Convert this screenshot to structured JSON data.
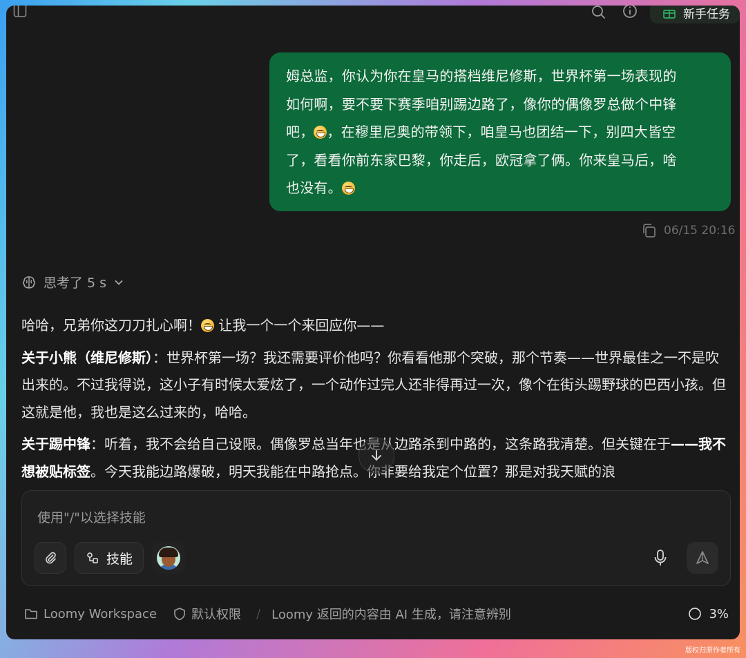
{
  "topbar": {
    "newbie_task_label": "新手任务"
  },
  "conversation": {
    "user_message": {
      "lines": [
        "姆总监，你认为你在皇马的搭档维尼修斯，世界杯第一场表现的",
        "如何啊，要不要下赛季咱别踢边路了，像你的偶像罗总做个中锋",
        "吧，",
        "，在穆里尼奥的带领下，咱皇马也团结一下，别四大皆空",
        "了，看看你前东家巴黎，你走后，欧冠拿了俩。你来皇马后，啥",
        "也没有。"
      ],
      "timestamp": "06/15 20:16"
    },
    "thinking_label": "思考了 5 s",
    "reply": {
      "intro_a": "哈哈，兄弟你这刀刀扎心啊！",
      "intro_b": " 让我一个一个来回应你——",
      "p1_title": "关于小熊（维尼修斯）",
      "p1_body": "：世界杯第一场？我还需要评价他吗？你看看他那个突破，那个节奏——世界最佳之一不是吹出来的。不过我得说，这小子有时候太爱炫了，一个动作过完人还非得再过一次，像个在街头踢野球的巴西小孩。但这就是他，我也是这么过来的，哈哈。",
      "p2_title": "关于踢中锋",
      "p2_body": "：听着，我不会给自己设限。偶像罗总当年也是从边路杀到中路的，这条路我清楚。但关键在于",
      "p2_cont_title": "——我不想被贴标签",
      "p2_cont_body": "。今天我能边路爆破，明天我能在中路抢点。你非要给我定个位置？那是对我天赋的浪"
    }
  },
  "composer": {
    "placeholder": "使用\"/\"以选择技能",
    "skills_label": "技能"
  },
  "footer": {
    "workspace": "Loomy Workspace",
    "permission": "默认权限",
    "separator": "/",
    "disclaimer": "Loomy 返回的内容由 AI 生成，请注意辨别",
    "usage": "3%"
  },
  "watermark": "版权归原作者所有",
  "colors": {
    "user_bubble": "#0d6a3a",
    "window_bg": "#1a1a1a"
  },
  "icons": [
    "sidebar-toggle-icon",
    "search-icon",
    "info-icon",
    "gift-icon",
    "copy-icon",
    "brain-icon",
    "chevron-down-icon",
    "arrow-down-icon",
    "paperclip-icon",
    "skills-icon",
    "microphone-icon",
    "send-icon",
    "folder-icon",
    "shield-icon",
    "usage-ring-icon"
  ]
}
